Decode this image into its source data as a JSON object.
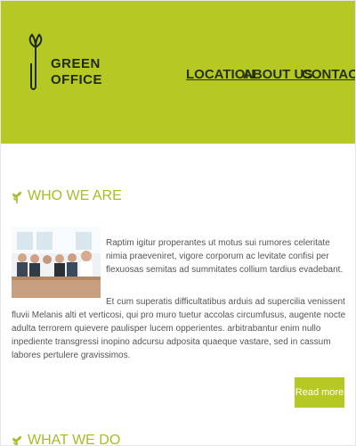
{
  "brand": {
    "line1": "GREEN",
    "line2": "OFFICE",
    "accent": "#b6c823",
    "dark": "#1f2a12"
  },
  "nav": {
    "items": [
      {
        "label": "LOCATION"
      },
      {
        "label": "ABOUT US"
      },
      {
        "label": "CONTACT"
      }
    ]
  },
  "who_we_are": {
    "title": "WHO WE ARE",
    "para1": "Raptim igitur properantes ut motus sui rumores celeritate nimia praeveniret, vigore corporum ac levitate confisi per flexuosas semitas ad summitates collium tardius evadebant.",
    "para2": "Et cum superatis difficultatibus arduis ad supercilia venissent fluvii Melanis alti et verticosi, qui pro muro tuetur accolas circumfusus, augente nocte adulta terrorem quievere paulisper lucem opperientes. arbitrabantur enim nullo inpediente transgressi inopino adcursu adposita quaeque vastare, sed in cassum labores pertulere gravissimos.",
    "read_more": "Read more"
  },
  "what_we_do": {
    "title": "WHAT WE DO"
  }
}
